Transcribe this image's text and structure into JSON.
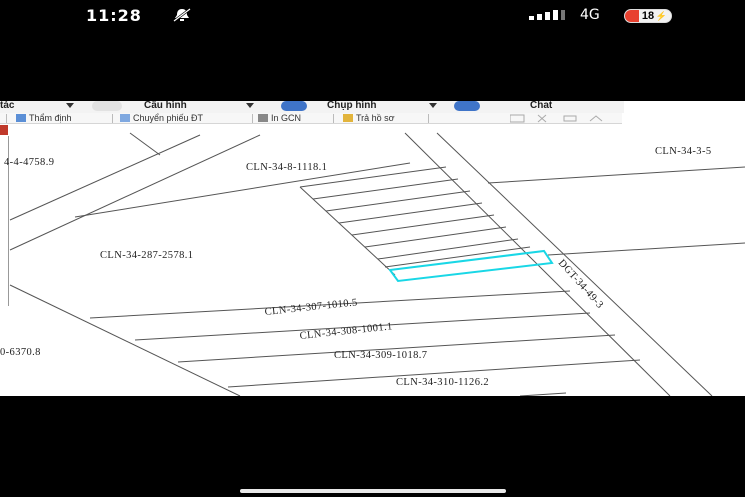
{
  "status_bar": {
    "time": "11:28",
    "network": "4G",
    "battery": "18"
  },
  "menu": {
    "items": [
      "tác",
      "Cấu hình",
      "Chụp hình",
      "Chat"
    ]
  },
  "toolbar": {
    "items": [
      "Thẩm định",
      "Chuyển phiếu ĐT",
      "In GCN",
      "Trả hồ sơ"
    ]
  },
  "map": {
    "parcels": [
      "4-4-4758.9",
      "CLN-34-8-1118.1",
      "CLN-34-3-5",
      "CLN-34-287-2578.1",
      "CLN-34-307-1010.5",
      "CLN-34-308-1001.1",
      "CLN-34-309-1018.7",
      "CLN-34-310-1126.2",
      "0-6370.8"
    ],
    "road_label": "DGT-34-49-3",
    "highlight_color": "#19d7e6"
  }
}
